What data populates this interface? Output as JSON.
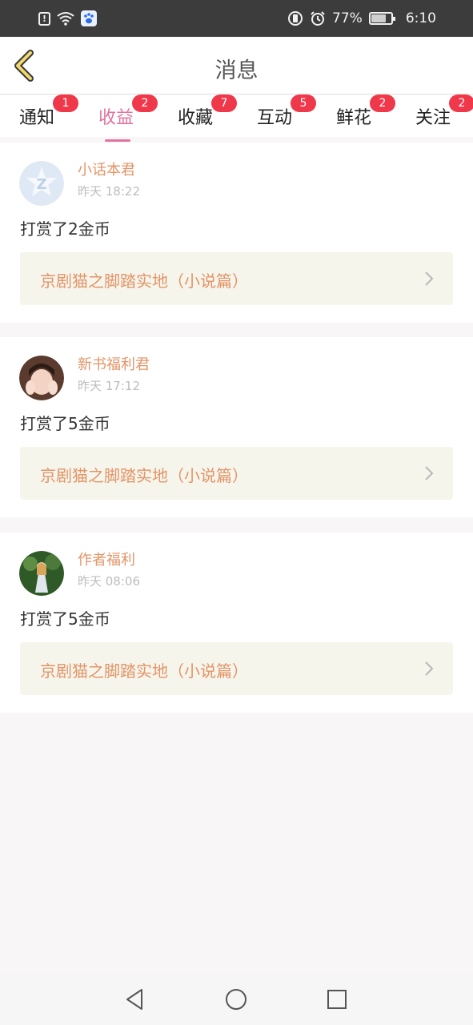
{
  "status_bar": {
    "battery": "77%",
    "battery_level": 0.77,
    "time": "6:10",
    "icons": [
      "alert-icon",
      "wifi-icon",
      "baidu-app-icon",
      "vibrate-icon",
      "alarm-icon",
      "battery-icon"
    ]
  },
  "header": {
    "title": "消息",
    "back_icon": "chevron-left-icon"
  },
  "tabs": [
    {
      "label": "通知",
      "badge": "1"
    },
    {
      "label": "收益",
      "badge": "2",
      "active": true
    },
    {
      "label": "收藏",
      "badge": "7"
    },
    {
      "label": "互动",
      "badge": "5"
    },
    {
      "label": "鲜花",
      "badge": "2"
    },
    {
      "label": "关注",
      "badge": "2"
    }
  ],
  "messages": [
    {
      "user": "小话本君",
      "time": "昨天 18:22",
      "text": "打赏了2金币",
      "book": "京剧猫之脚踏实地（小说篇）"
    },
    {
      "user": "新书福利君",
      "time": "昨天 17:12",
      "text": "打赏了5金币",
      "book": "京剧猫之脚踏实地（小说篇）"
    },
    {
      "user": "作者福利",
      "time": "昨天 08:06",
      "text": "打赏了5金币",
      "book": "京剧猫之脚踏实地（小说篇）"
    }
  ],
  "colors": {
    "accent": "#e2739f",
    "name_color": "#e39467",
    "badge": "#f0384b"
  }
}
